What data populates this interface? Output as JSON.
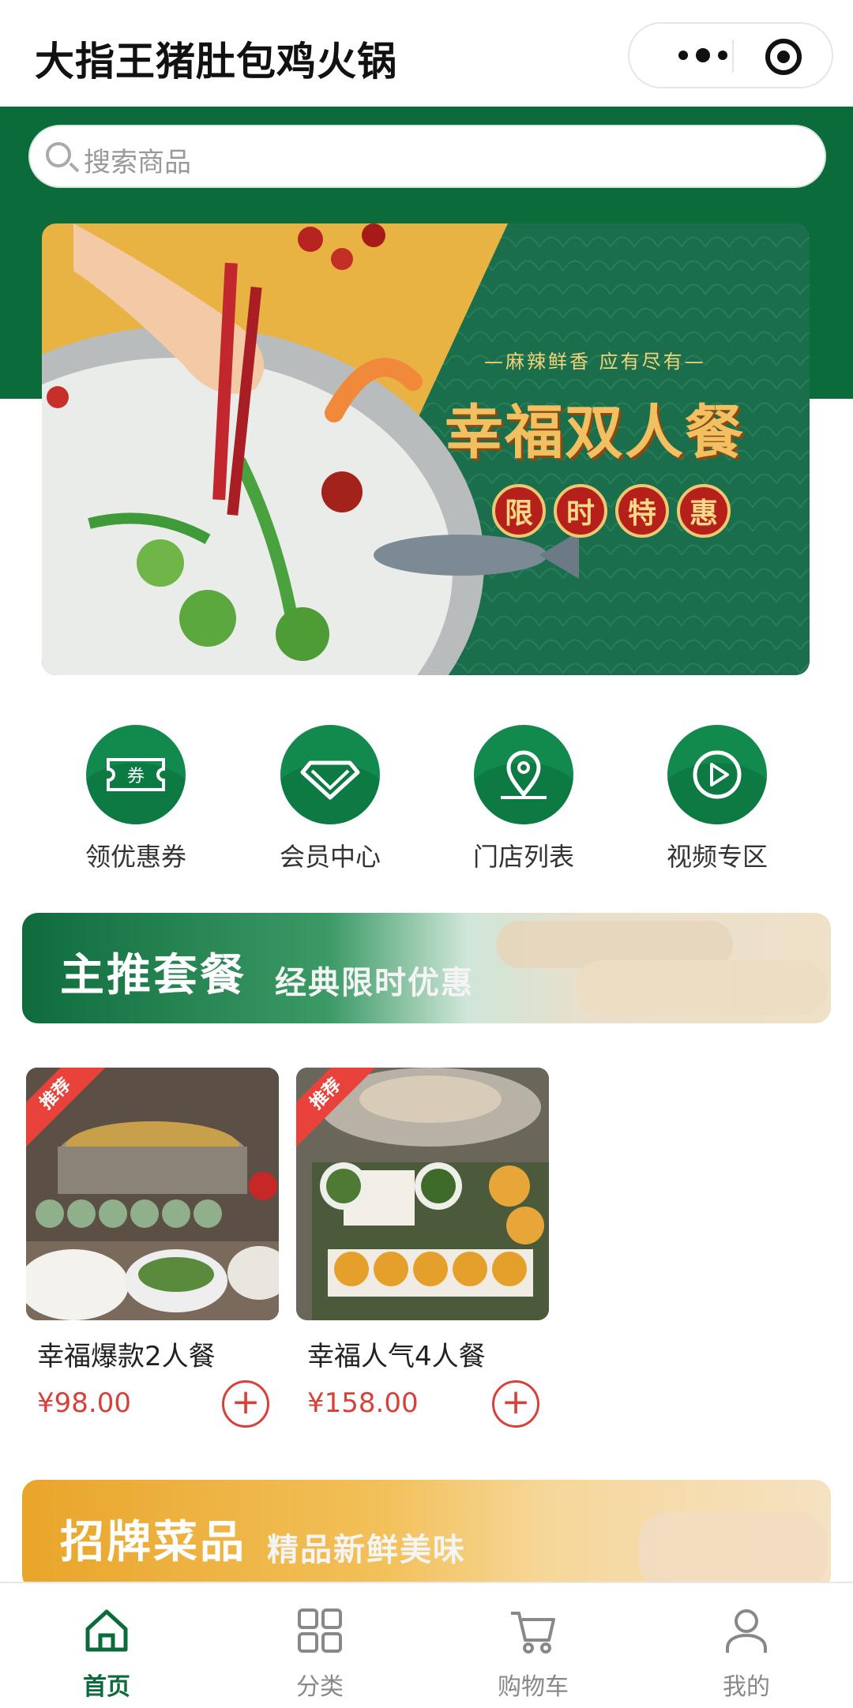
{
  "app": {
    "title": "大指王猪肚包鸡火锅"
  },
  "search": {
    "placeholder": "搜索商品"
  },
  "banner": {
    "subtitle": "—麻辣鲜香 应有尽有—",
    "title": "幸福双人餐",
    "seals": [
      "限",
      "时",
      "特",
      "惠"
    ]
  },
  "quick_menu": [
    {
      "label": "领优惠券",
      "icon": "coupon-icon"
    },
    {
      "label": "会员中心",
      "icon": "diamond-icon"
    },
    {
      "label": "门店列表",
      "icon": "location-pin-icon"
    },
    {
      "label": "视频专区",
      "icon": "play-icon"
    }
  ],
  "section_main": {
    "title": "主推套餐",
    "subtitle": "经典限时优惠"
  },
  "products": [
    {
      "name": "幸福爆款2人餐",
      "price": "¥98.00",
      "badge": "推荐"
    },
    {
      "name": "幸福人气4人餐",
      "price": "¥158.00",
      "badge": "推荐"
    }
  ],
  "section_sign": {
    "title": "招牌菜品",
    "subtitle": "精品新鲜美味"
  },
  "tabs": [
    {
      "label": "首页",
      "icon": "home-icon",
      "active": true
    },
    {
      "label": "分类",
      "icon": "grid-icon",
      "active": false
    },
    {
      "label": "购物车",
      "icon": "cart-icon",
      "active": false
    },
    {
      "label": "我的",
      "icon": "user-icon",
      "active": false
    }
  ],
  "colors": {
    "brand_green": "#0c6b3a",
    "price_red": "#d8403a",
    "badge_red": "#e8423a"
  }
}
